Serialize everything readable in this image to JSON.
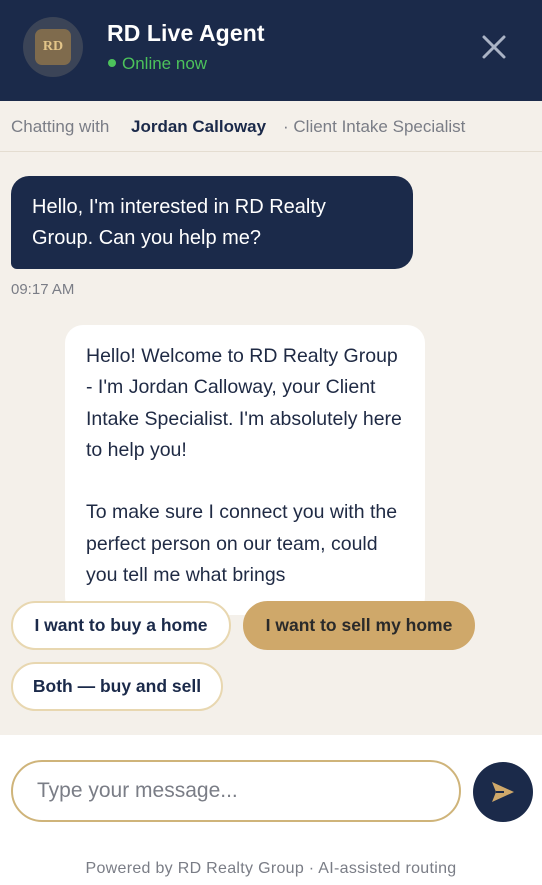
{
  "header": {
    "logo_text": "RD",
    "title": "RD Live Agent",
    "status": "Online now",
    "close_icon": "close-icon"
  },
  "subheader": {
    "prefix": "Chatting with",
    "agent_name": "Jordan Calloway",
    "agent_role": "· Client Intake Specialist"
  },
  "messages": [
    {
      "from": "user",
      "text": "Hello, I'm interested in RD Realty Group. Can you help me?",
      "time": "09:17 AM"
    },
    {
      "from": "agent",
      "text": "Hello! Welcome to RD Realty Group - I'm Jordan Calloway, your Client Intake Specialist. I'm absolutely here to help you!\n\nTo make sure I connect you with the perfect person on our team, could you tell me what brings"
    }
  ],
  "quick_replies": [
    {
      "label": "I want to buy a home"
    },
    {
      "label": "I want to sell my home"
    },
    {
      "label": "Both — buy and sell"
    }
  ],
  "composer": {
    "placeholder": "Type your message...",
    "value": "",
    "send_icon": "send-icon"
  },
  "footer": "Powered by RD Realty Group · AI-assisted routing",
  "colors": {
    "navy": "#1b2a4a",
    "gold": "#cfa86a",
    "online_green": "#4cc25b",
    "background": "#f4f0ea"
  }
}
